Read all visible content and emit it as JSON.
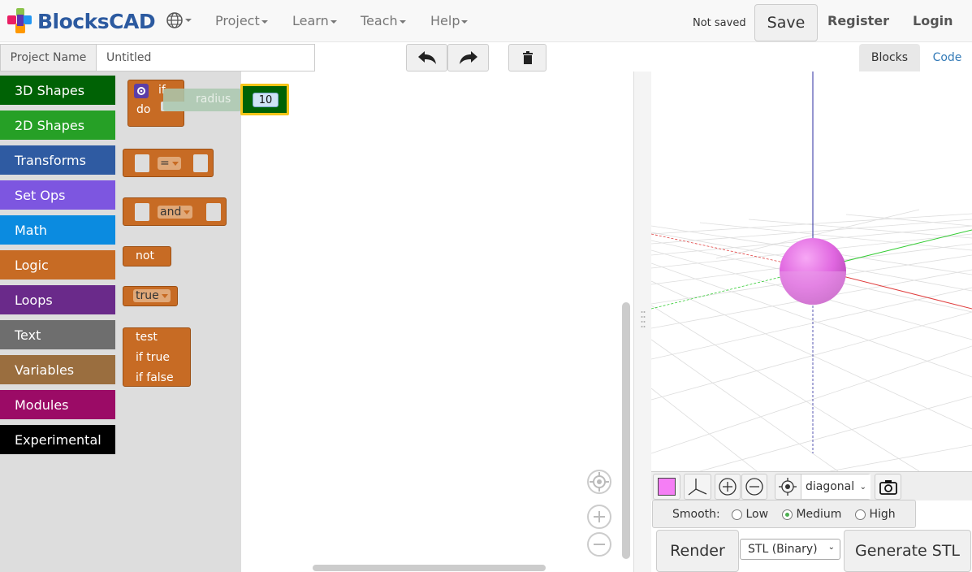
{
  "app": {
    "name": "BlocksCAD"
  },
  "navbar": {
    "menus": [
      {
        "label": "Project"
      },
      {
        "label": "Learn"
      },
      {
        "label": "Teach"
      },
      {
        "label": "Help"
      }
    ],
    "save_status": "Not saved",
    "save_label": "Save",
    "register_label": "Register",
    "login_label": "Login"
  },
  "project": {
    "label": "Project Name",
    "value": "Untitled"
  },
  "tabs": {
    "blocks": "Blocks",
    "code": "Code"
  },
  "toolbox": {
    "categories": [
      {
        "label": "3D Shapes",
        "color": "#006205"
      },
      {
        "label": "2D Shapes",
        "color": "#26a026"
      },
      {
        "label": "Transforms",
        "color": "#2f5ba2"
      },
      {
        "label": "Set Ops",
        "color": "#7d56e0"
      },
      {
        "label": "Math",
        "color": "#0b8be0"
      },
      {
        "label": "Logic",
        "color": "#c76b24"
      },
      {
        "label": "Loops",
        "color": "#6a2a8a"
      },
      {
        "label": "Text",
        "color": "#6e6e6e"
      },
      {
        "label": "Variables",
        "color": "#9a6e3f"
      },
      {
        "label": "Modules",
        "color": "#9b0b66"
      },
      {
        "label": "Experimental",
        "color": "#000000"
      }
    ]
  },
  "flyout": {
    "if_block": {
      "if": "if",
      "do": "do"
    },
    "dragged_block": {
      "label": "radius",
      "value": "10"
    },
    "compare_block": {
      "op": "="
    },
    "and_block": {
      "op": "and"
    },
    "not_block": {
      "label": "not"
    },
    "bool_block": {
      "value": "true"
    },
    "ternary_block": {
      "test": "test",
      "if_true": "if true",
      "if_false": "if false"
    }
  },
  "viewer": {
    "color_swatch": "#f57ef5",
    "view_select": "diagonal",
    "smooth_label": "Smooth:",
    "smooth_options": [
      {
        "label": "Low",
        "selected": false
      },
      {
        "label": "Medium",
        "selected": true
      },
      {
        "label": "High",
        "selected": false
      }
    ],
    "render_label": "Render",
    "format_select": "STL (Binary)",
    "generate_label": "Generate STL"
  }
}
